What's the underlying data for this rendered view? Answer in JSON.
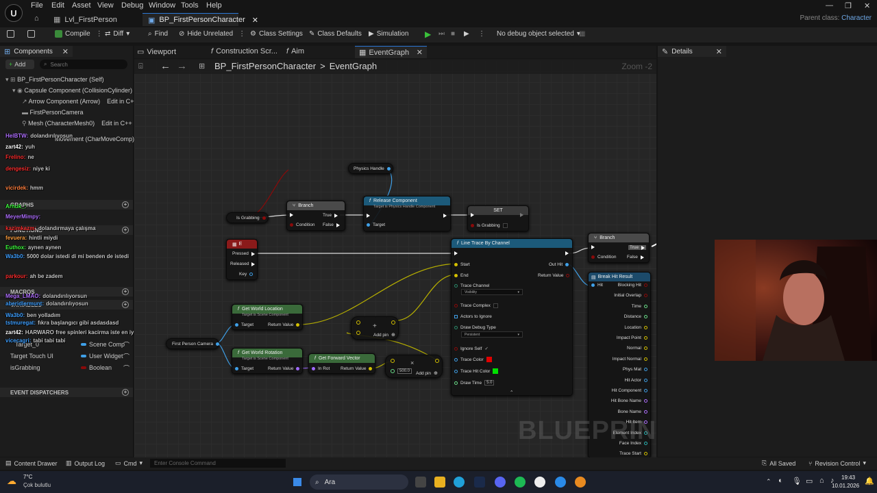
{
  "menu": [
    "File",
    "Edit",
    "Asset",
    "View",
    "Debug",
    "Window",
    "Tools",
    "Help"
  ],
  "tabs": [
    {
      "label": "Lvl_FirstPerson"
    },
    {
      "label": "BP_FirstPersonCharacter"
    }
  ],
  "parent_class": {
    "label": "Parent class:",
    "value": "Character"
  },
  "toolbar": {
    "compile": "Compile",
    "diff": "Diff",
    "find": "Find",
    "hide_unrelated": "Hide Unrelated",
    "class_settings": "Class Settings",
    "class_defaults": "Class Defaults",
    "simulation": "Simulation",
    "debug_object": "No debug object selected"
  },
  "components_panel": {
    "title": "Components",
    "add": "Add",
    "search_placeholder": "Search",
    "tree": [
      {
        "label": "BP_FirstPersonCharacter (Self)"
      },
      {
        "label": "Capsule Component (CollisionCylinder)"
      },
      {
        "label": "Arrow Component (Arrow)",
        "edit": "Edit in C++"
      },
      {
        "label": "FirstPersonCamera"
      },
      {
        "label": "Mesh (CharacterMesh0)",
        "edit": "Edit in C++"
      },
      {
        "label": "Movement (CharMoveComp)"
      }
    ]
  },
  "variables": [
    {
      "name": "Target_0",
      "type": "Scene Comp",
      "color": "#3fa0e8"
    },
    {
      "name": "Target Touch UI",
      "type": "User Widget",
      "color": "#3fa0e8"
    },
    {
      "name": "isGrabbing",
      "type": "Boolean",
      "color": "#8a0a0a"
    }
  ],
  "categories": {
    "event_dispatchers": "EVENT DISPATCHERS",
    "macros": "MACROS",
    "variables": "VARIABLES",
    "graphs": "GRAPHS",
    "functions": "FUNCTIONS"
  },
  "chat": [
    {
      "user": "HelBTW:",
      "msg": "dolandırılıyosun",
      "color": "#b070ff"
    },
    {
      "user": "zart42:",
      "msg": "yuh",
      "color": "#ffffff"
    },
    {
      "user": "Frelino:",
      "msg": "ne",
      "color": "#ff3030"
    },
    {
      "user": "dengesiz:",
      "msg": "niye ki",
      "color": "#ff3030"
    },
    {
      "user": "vicirdek:",
      "msg": "hmm",
      "color": "#ff8040"
    },
    {
      "user": "Arhuk_:",
      "msg": "",
      "color": "#40ff40"
    },
    {
      "user": "MeyerMimpy:",
      "msg": "",
      "color": "#b070ff"
    },
    {
      "user": "kazimkazm:",
      "msg": "dolandırmaya çalışma",
      "color": "#ff3030"
    },
    {
      "user": "fevuera:",
      "msg": "hintli miydi",
      "color": "#ffa040"
    },
    {
      "user": "Euthox:",
      "msg": "aynen aynen",
      "color": "#40ff40"
    },
    {
      "user": "Wa3b0:",
      "msg": "5000 dolar istedi di mi benden de istedi",
      "color": "#40a0ff"
    },
    {
      "user": "parkour:",
      "msg": "ah be zadem",
      "color": "#ff3030"
    },
    {
      "user": "Mega_LMAO:",
      "msg": "dolandırılıyorsun",
      "color": "#b070ff"
    },
    {
      "user": "aberidlermunt:",
      "msg": "dolandırılıyosun",
      "color": "#40a0ff"
    },
    {
      "user": "Wa3b0:",
      "msg": "ben yolladım",
      "color": "#40a0ff"
    },
    {
      "user": "tstmuregat:",
      "msg": "fıkra başlangıcı gibi asdasdasd",
      "color": "#40a0ff"
    },
    {
      "user": "zart42:",
      "msg": "HARWARO free spinleri kacirma iste en iyi freespinler",
      "color": "#ffffff"
    },
    {
      "user": "vicecagri:",
      "msg": "tabi tabi tabi",
      "color": "#40a0ff"
    }
  ],
  "graph_tabs": [
    {
      "label": "Viewport"
    },
    {
      "label": "Construction Scr..."
    },
    {
      "label": "Aim"
    },
    {
      "label": "EventGraph"
    }
  ],
  "breadcrumb": {
    "root": "BP_FirstPersonCharacter",
    "sep": ">",
    "leaf": "EventGraph",
    "zoom": "Zoom -2"
  },
  "nodes": {
    "physics_handle": "Physics Handle",
    "is_grabbing": "Is Grabbing",
    "branch1": {
      "title": "Branch",
      "condition": "Condition",
      "true": "True",
      "false": "False"
    },
    "release": {
      "title": "Release Component",
      "sub": "Target is Physics Handle Component",
      "target": "Target"
    },
    "set": {
      "title": "SET",
      "pin": "Is Grabbing"
    },
    "e_key": {
      "title": "E",
      "pressed": "Pressed",
      "released": "Released",
      "key": "Key"
    },
    "line_trace": {
      "title": "Line Trace By Channel",
      "start": "Start",
      "end": "End",
      "out_hit": "Out Hit",
      "return_value": "Return Value",
      "trace_channel": "Trace Channel",
      "channel_value": "Visibility",
      "trace_complex": "Trace Complex",
      "actors_to_ignore": "Actors to Ignore",
      "debug_type": "Draw Debug Type",
      "debug_value": "Persistent",
      "ignore_self": "Ignore Self",
      "trace_color": "Trace Color",
      "hit_color": "Trace Hit Color",
      "draw_time": "Draw Time",
      "draw_time_value": "5.0"
    },
    "branch2": {
      "title": "Branch",
      "condition": "Condition",
      "true": "True",
      "false": "False"
    },
    "break_hit": {
      "title": "Break Hit Result",
      "hit": "Hit",
      "pins": [
        "Blocking Hit",
        "Initial Overlap",
        "Time",
        "Distance",
        "Location",
        "Impact Point",
        "Normal",
        "Impact Normal",
        "Phys Mat",
        "Hit Actor",
        "Hit Component",
        "Hit Bone Name",
        "Bone Name",
        "Hit Item",
        "Element Index",
        "Face Index",
        "Trace Start"
      ]
    },
    "get_world_location": {
      "title": "Get World Location",
      "sub": "Target is Scene Component",
      "target": "Target",
      "return_value": "Return Value"
    },
    "get_world_rotation": {
      "title": "Get World Rotation",
      "sub": "Target is Scene Component",
      "target": "Target",
      "return_value": "Return Value"
    },
    "get_forward": {
      "title": "Get Forward Vector",
      "in_rot": "In Rot",
      "return_value": "Return Value"
    },
    "first_person_camera": "First Person Camera",
    "add_pin": "Add pin",
    "multiply_value": "500.0",
    "watermark": "BLUEPRINT"
  },
  "details": {
    "title": "Details"
  },
  "bottom": {
    "content_drawer": "Content Drawer",
    "output_log": "Output Log",
    "cmd": "Cmd",
    "console_placeholder": "Enter Console Command",
    "all_saved": "All Saved",
    "revision_control": "Revision Control"
  },
  "taskbar": {
    "weather_temp": "7°C",
    "weather_desc": "Çok bulutlu",
    "search": "Ara",
    "time": "19:43",
    "date": "10.01.2026"
  }
}
